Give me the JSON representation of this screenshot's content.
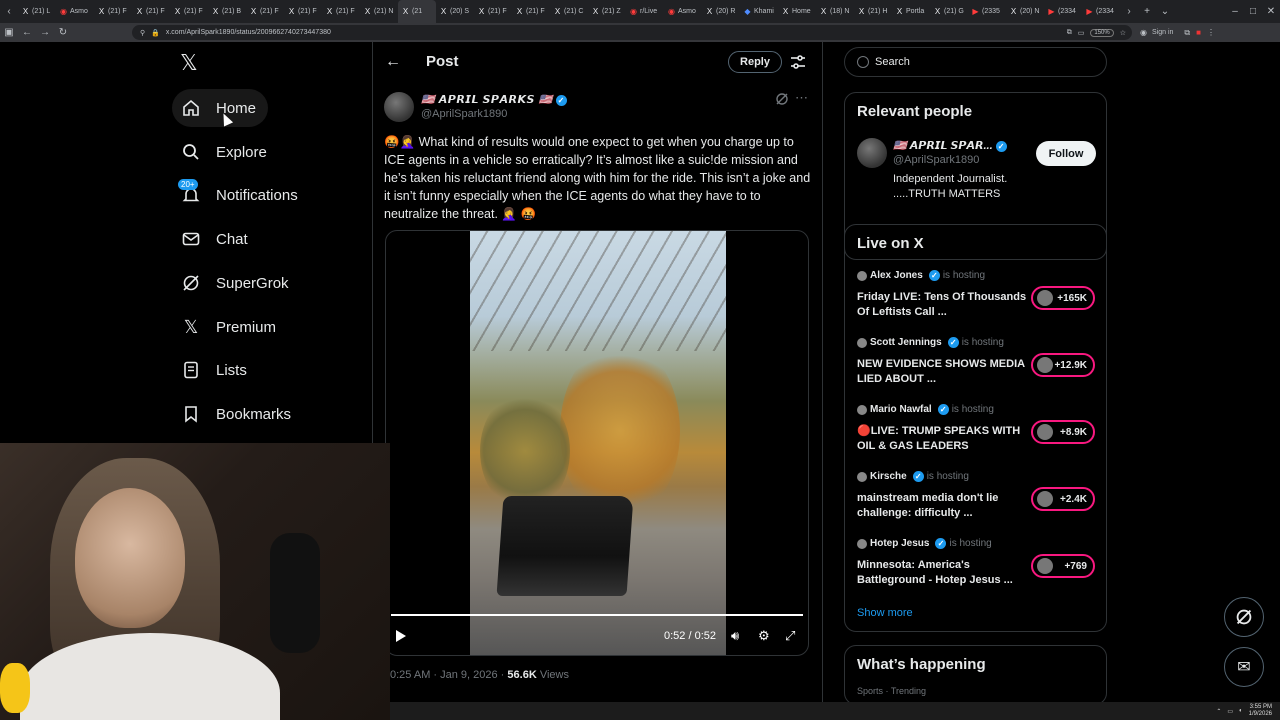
{
  "browser": {
    "tabs": [
      {
        "icon": "X",
        "label": "(21) L"
      },
      {
        "icon": "◉",
        "label": "Asmo"
      },
      {
        "icon": "X",
        "label": "(21) F"
      },
      {
        "icon": "X",
        "label": "(21) F"
      },
      {
        "icon": "X",
        "label": "(21) F"
      },
      {
        "icon": "X",
        "label": "(21) B"
      },
      {
        "icon": "X",
        "label": "(21) F"
      },
      {
        "icon": "X",
        "label": "(21) F"
      },
      {
        "icon": "X",
        "label": "(21) F"
      },
      {
        "icon": "X",
        "label": "(21) N"
      },
      {
        "icon": "X",
        "label": "(21"
      },
      {
        "icon": "X",
        "label": "(20) S"
      },
      {
        "icon": "X",
        "label": "(21) F"
      },
      {
        "icon": "X",
        "label": "(21) F"
      },
      {
        "icon": "X",
        "label": "(21) C"
      },
      {
        "icon": "X",
        "label": "(21) Z"
      },
      {
        "icon": "◉",
        "label": "r/Live"
      },
      {
        "icon": "◉",
        "label": "Asmo"
      },
      {
        "icon": "X",
        "label": "(20) R"
      },
      {
        "icon": "◆",
        "label": "Khami"
      },
      {
        "icon": "X",
        "label": "Home"
      },
      {
        "icon": "X",
        "label": "(18) N"
      },
      {
        "icon": "X",
        "label": "(21) H"
      },
      {
        "icon": "X",
        "label": "Portla"
      },
      {
        "icon": "X",
        "label": "(21) G"
      },
      {
        "icon": "▶",
        "label": "(2335"
      },
      {
        "icon": "X",
        "label": "(20) N"
      },
      {
        "icon": "▶",
        "label": "(2334"
      },
      {
        "icon": "▶",
        "label": "(2334"
      }
    ],
    "url": "x.com/AprilSpark1890/status/2009662740273447380",
    "zoom": "150%",
    "signin": "Sign in"
  },
  "nav": {
    "items": [
      {
        "label": "Home",
        "icon": "home-icon"
      },
      {
        "label": "Explore",
        "icon": "search-icon"
      },
      {
        "label": "Notifications",
        "icon": "bell-icon",
        "badge": "20+"
      },
      {
        "label": "Chat",
        "icon": "mail-icon"
      },
      {
        "label": "SuperGrok",
        "icon": "grok-icon"
      },
      {
        "label": "Premium",
        "icon": "x-logo-icon"
      },
      {
        "label": "Lists",
        "icon": "list-icon"
      },
      {
        "label": "Bookmarks",
        "icon": "bookmark-icon"
      }
    ]
  },
  "post": {
    "header_title": "Post",
    "reply_label": "Reply",
    "author_name": "🇺🇸 𝘼𝙋𝙍𝙄𝙇 𝙎𝙋𝘼𝙍𝙆𝙎 🇺🇸",
    "author_handle": "@AprilSpark1890",
    "text": "🤬🤦‍♀️ What kind of results would one expect to get when you charge up to ICE agents in a vehicle so erratically?  It’s almost like a suic!de mission and he’s taken his reluctant friend along with him for the ride.  This isn’t a joke and it isn’t funny especially when the ICE agents do what they have to to neutralize the threat. 🤦‍♀️ 🤬",
    "video_time": "0:52 / 0:52",
    "video_progress": 1.0,
    "timestamp": "0:25 AM · Jan 9, 2026 · ",
    "views_count": "56.6K",
    "views_label": " Views"
  },
  "right": {
    "search_placeholder": "Search",
    "relevant_title": "Relevant people",
    "relevant": {
      "name": "🇺🇸 𝘼𝙋𝙍𝙄𝙇 𝙎𝙋𝘼𝙍...",
      "handle": "@AprilSpark1890",
      "bio": "Independent Journalist. .....TRUTH MATTERS",
      "follow_label": "Follow"
    },
    "live_title": "Live on X",
    "live": [
      {
        "host": "Alex Jones",
        "status": "is hosting",
        "title": "Friday LIVE: Tens Of Thousands Of Leftists Call ...",
        "count": "+165K"
      },
      {
        "host": "Scott Jennings",
        "status": "is hosting",
        "title": "NEW EVIDENCE SHOWS MEDIA LIED ABOUT ...",
        "count": "+12.9K"
      },
      {
        "host": "Mario Nawfal",
        "status": "is hosting",
        "title": "🔴LIVE: TRUMP SPEAKS WITH OIL & GAS LEADERS",
        "count": "+8.9K"
      },
      {
        "host": "Kirsche",
        "status": "is hosting",
        "title": "mainstream media don't lie challenge: difficulty ...",
        "count": "+2.4K"
      },
      {
        "host": "Hotep Jesus",
        "status": "is hosting",
        "title": "Minnesota: America's Battleground - Hotep Jesus ...",
        "count": "+769"
      }
    ],
    "show_more": "Show more",
    "happening_title": "What’s happening",
    "happening_sub": "Sports · Trending"
  },
  "taskbar": {
    "time": "3:55 PM",
    "date": "1/9/2026"
  },
  "colors": {
    "accent": "#1d9bf0",
    "live_border": "#f91880",
    "background": "#000000"
  }
}
